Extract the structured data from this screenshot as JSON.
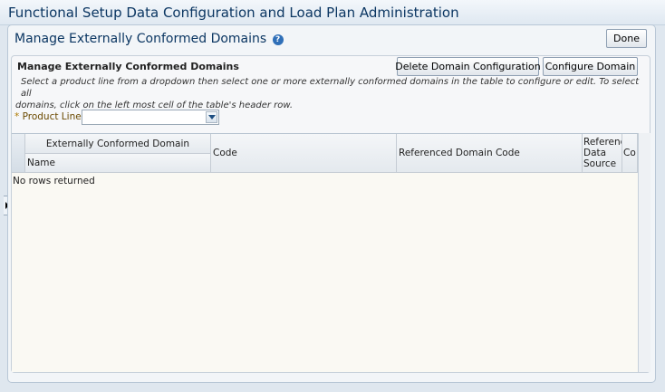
{
  "app": {
    "title": "Functional Setup Data Configuration and Load Plan Administration"
  },
  "page": {
    "title": "Manage Externally Conformed Domains",
    "help_icon": "help-icon",
    "done_label": "Done"
  },
  "panel": {
    "title": "Manage Externally Conformed Domains",
    "delete_label": "Delete Domain Configuration",
    "configure_label": "Configure Domain",
    "instructions_line1": "Select a product line from a dropdown then select one or more externally conformed domains in the table to configure or edit. To select all",
    "instructions_line2": "domains, click on the left most cell of the table's header row."
  },
  "product_line": {
    "required_marker": "*",
    "label": "Product Line",
    "value": ""
  },
  "table": {
    "group_header": "Externally Conformed Domain",
    "columns": {
      "name": "Name",
      "code": "Code",
      "referenced_domain_code": "Referenced Domain Code",
      "referenced_data_source": "Referenced Data Source",
      "con": "Co"
    },
    "empty_message": "No rows returned"
  }
}
